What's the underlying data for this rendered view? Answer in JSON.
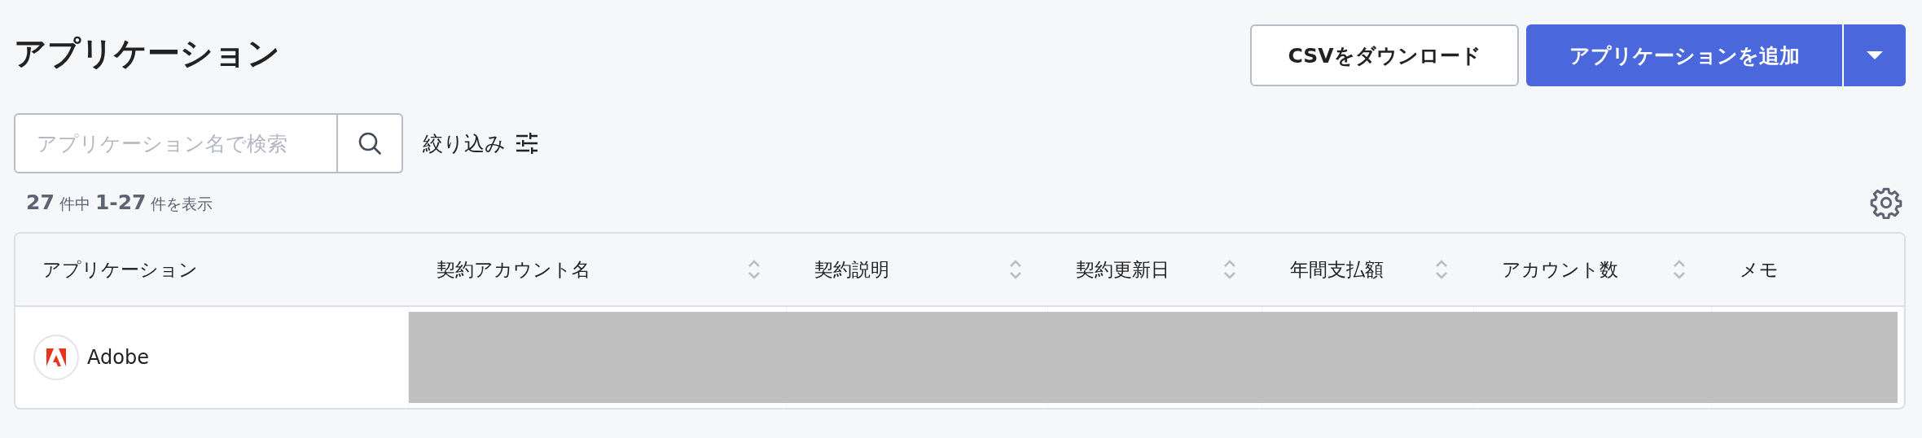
{
  "page": {
    "title": "アプリケーション"
  },
  "actions": [
    {
      "kind": "secondary",
      "label": "CSVをダウンロード"
    },
    {
      "kind": "split",
      "label": "アプリケーションを追加"
    }
  ],
  "search": {
    "placeholder": "アプリケーション名で検索"
  },
  "filter": {
    "label": "絞り込み"
  },
  "result_count": "**27** 件中 **1-27** 件を表示",
  "table": {
    "columns": [
      {
        "label": "アプリケーション",
        "sortable": false
      },
      {
        "label": "契約アカウント名",
        "sortable": true
      },
      {
        "label": "契約説明",
        "sortable": true
      },
      {
        "label": "契約更新日",
        "sortable": true
      },
      {
        "label": "年間支払額",
        "sortable": true
      },
      {
        "label": "アカウント数",
        "sortable": true
      },
      {
        "label": "メモ",
        "sortable": false
      }
    ],
    "rows": [
      {
        "application": "Adobe",
        "redacted": true
      }
    ]
  }
}
